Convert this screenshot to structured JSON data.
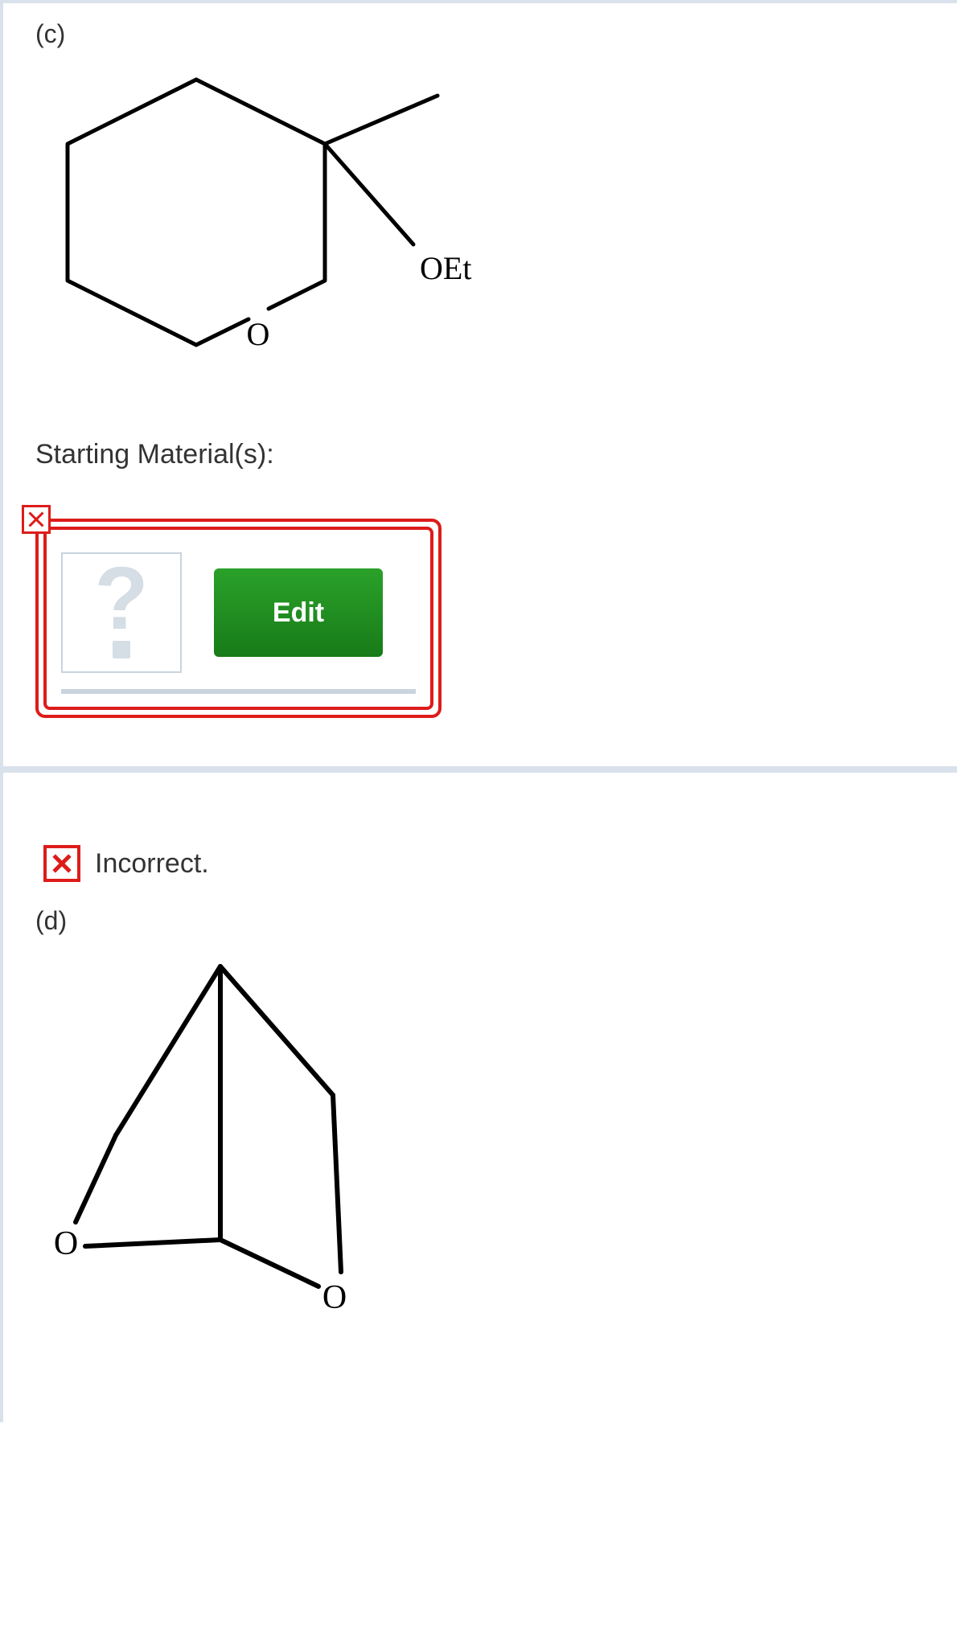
{
  "parts": {
    "c": {
      "label": "(c)",
      "structure_atoms": {
        "ring_o": "O",
        "oet": "OEt"
      },
      "section_label": "Starting Material(s):",
      "placeholder_glyph": "?",
      "edit_label": "Edit"
    },
    "d": {
      "label": "(d)",
      "feedback": "Incorrect.",
      "structure_atoms": {
        "o_left": "O",
        "o_right": "O"
      }
    }
  }
}
